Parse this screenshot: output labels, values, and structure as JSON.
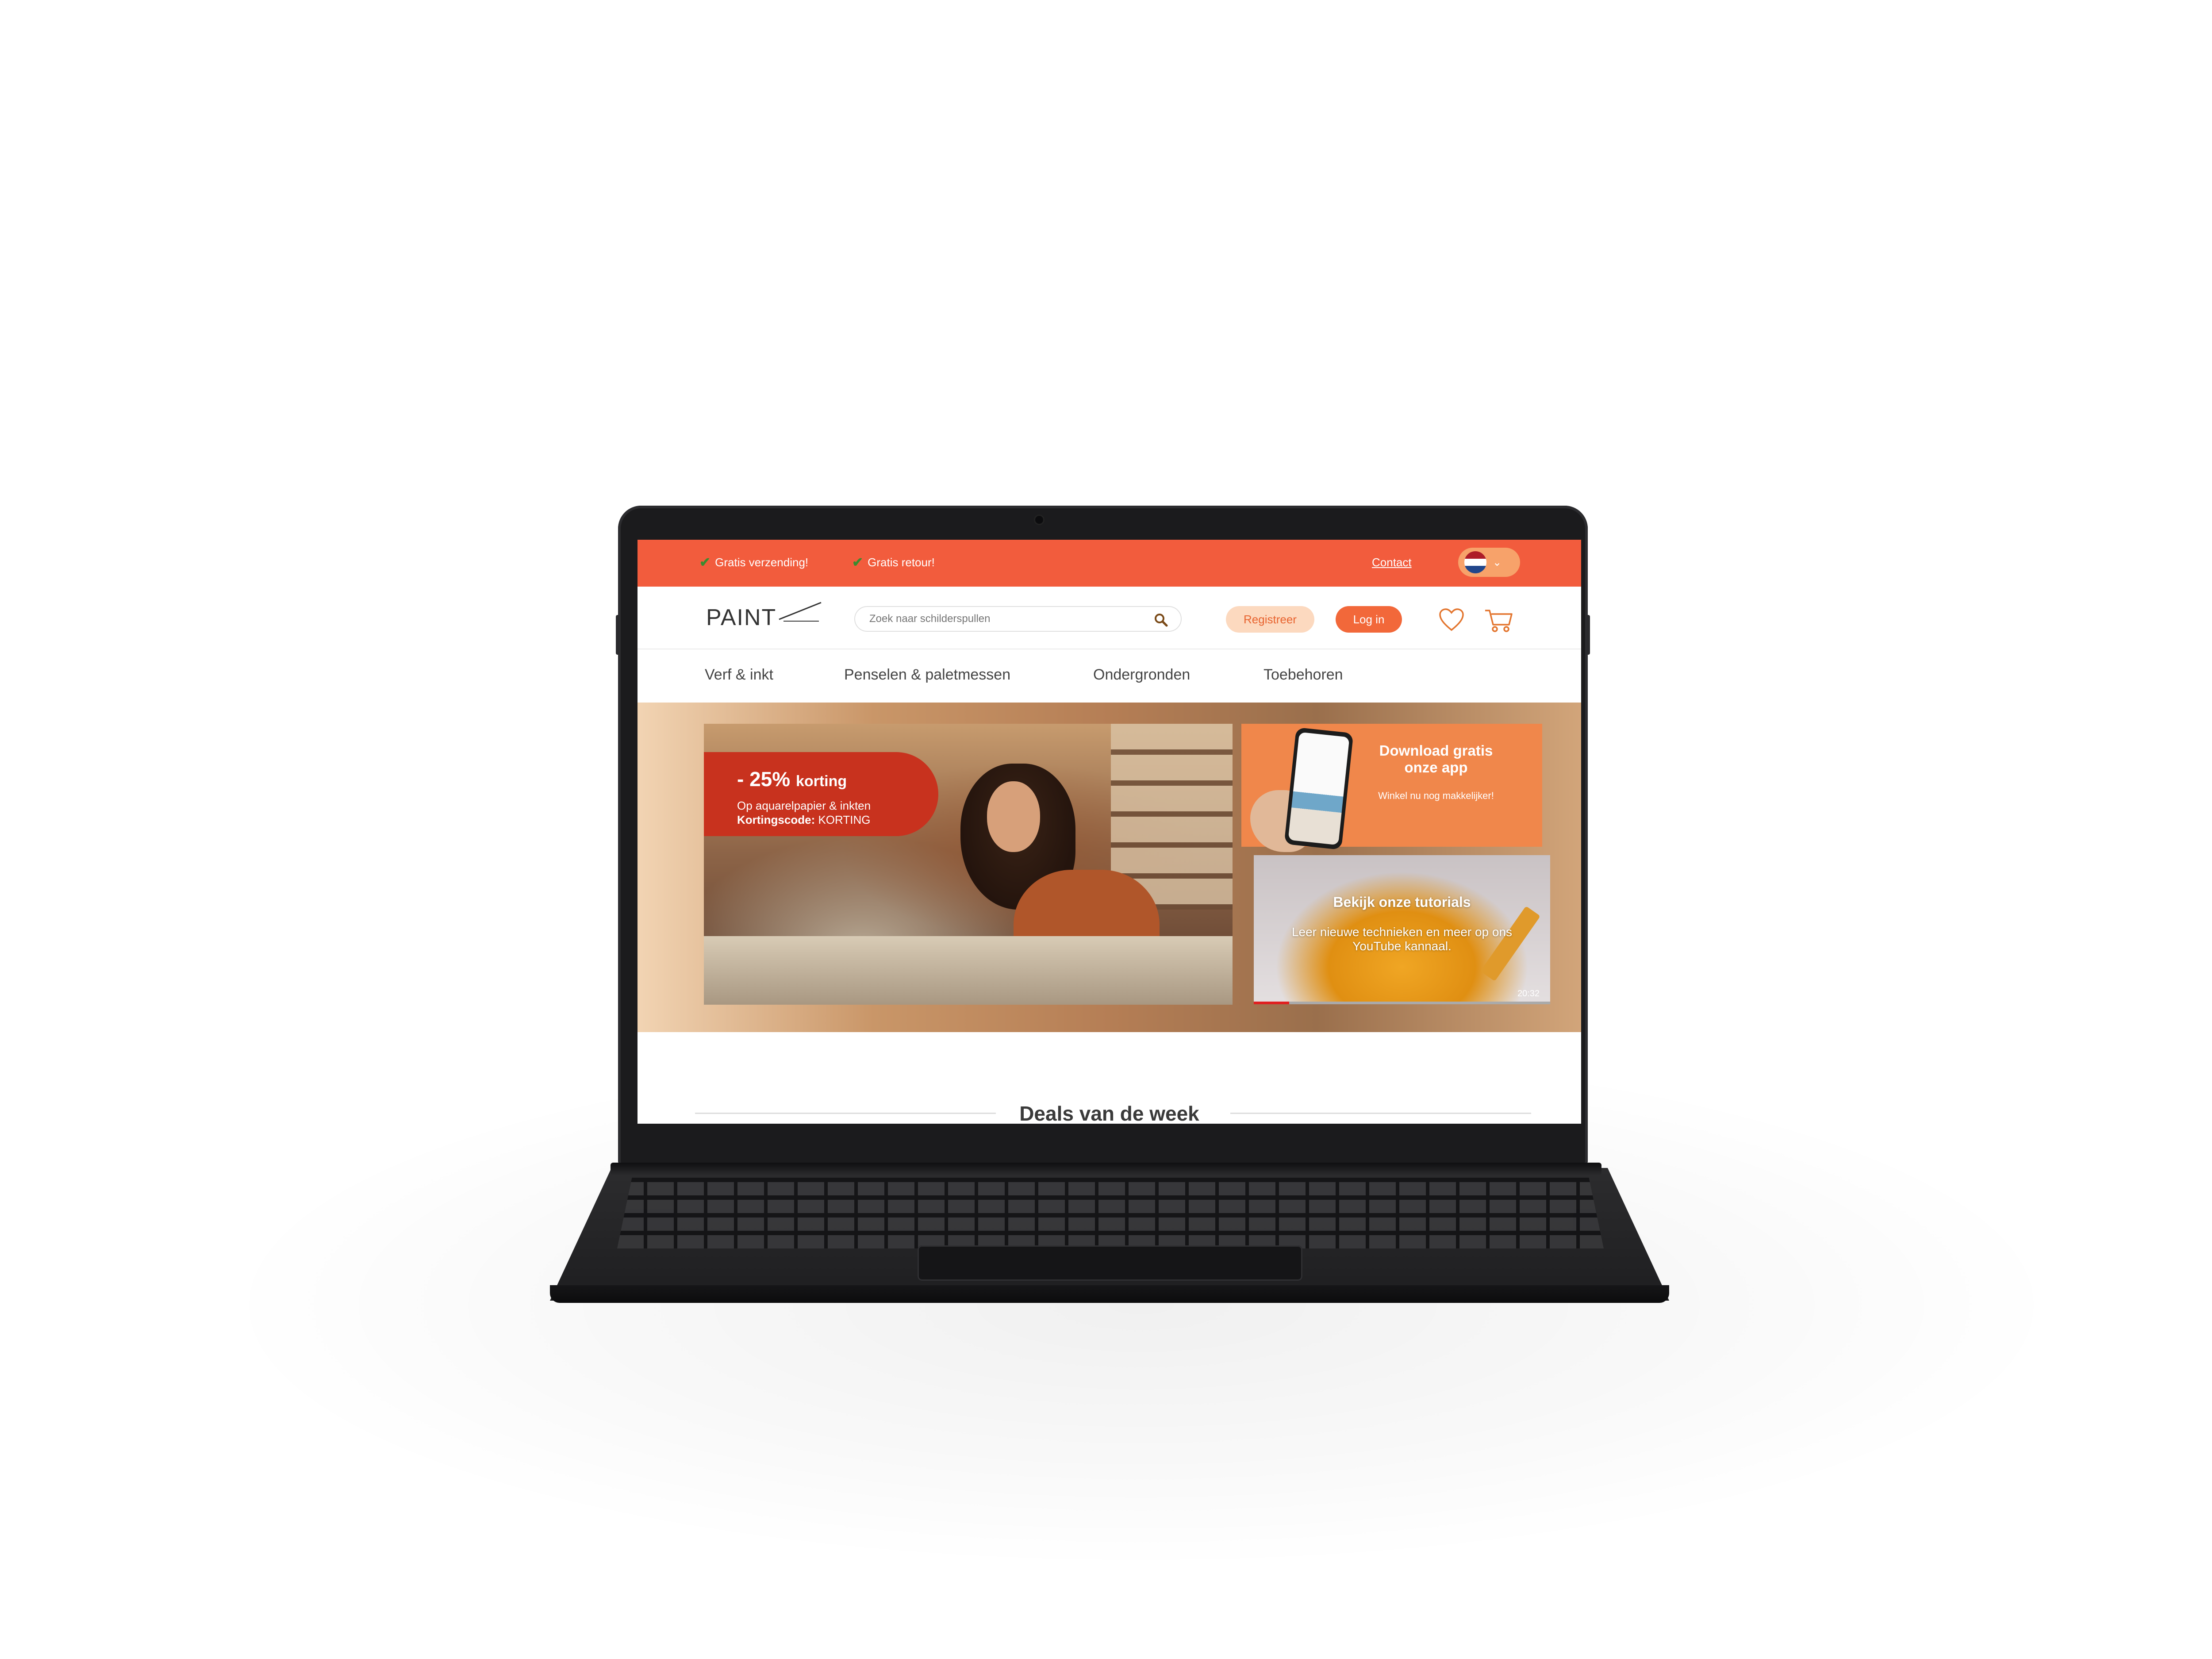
{
  "topbar": {
    "usp_1": "Gratis verzending!",
    "usp_2": "Gratis retour!",
    "contact": "Contact",
    "language": "NL",
    "flag_colors": [
      "#ae1c28",
      "#ffffff",
      "#21468b"
    ]
  },
  "header": {
    "logo": "PAINT",
    "search_placeholder": "Zoek naar schilderspullen",
    "register": "Registreer",
    "login": "Log in"
  },
  "nav": {
    "items": [
      {
        "label": "Verf & inkt"
      },
      {
        "label": "Penselen & paletmessen"
      },
      {
        "label": "Ondergronden"
      },
      {
        "label": "Toebehoren"
      }
    ]
  },
  "hero": {
    "promo": {
      "discount": "- 25%",
      "discount_suffix": "korting",
      "line1": "Op aquarelpapier & inkten",
      "code_label": "Kortingscode:",
      "code_value": "KORTING"
    },
    "app": {
      "title": "Download gratis onze app",
      "subtitle": "Winkel nu nog makkelijker!"
    },
    "tutorial": {
      "title": "Bekijk onze tutorials",
      "subtitle": "Leer nieuwe technieken en meer op ons YouTube kannaal.",
      "duration": "20:32",
      "progress": 0.12
    }
  },
  "deals": {
    "title": "Deals van de week"
  },
  "colors": {
    "brand": "#f25c3d",
    "accent": "#f2683a",
    "register_bg": "#fcd9bf"
  }
}
